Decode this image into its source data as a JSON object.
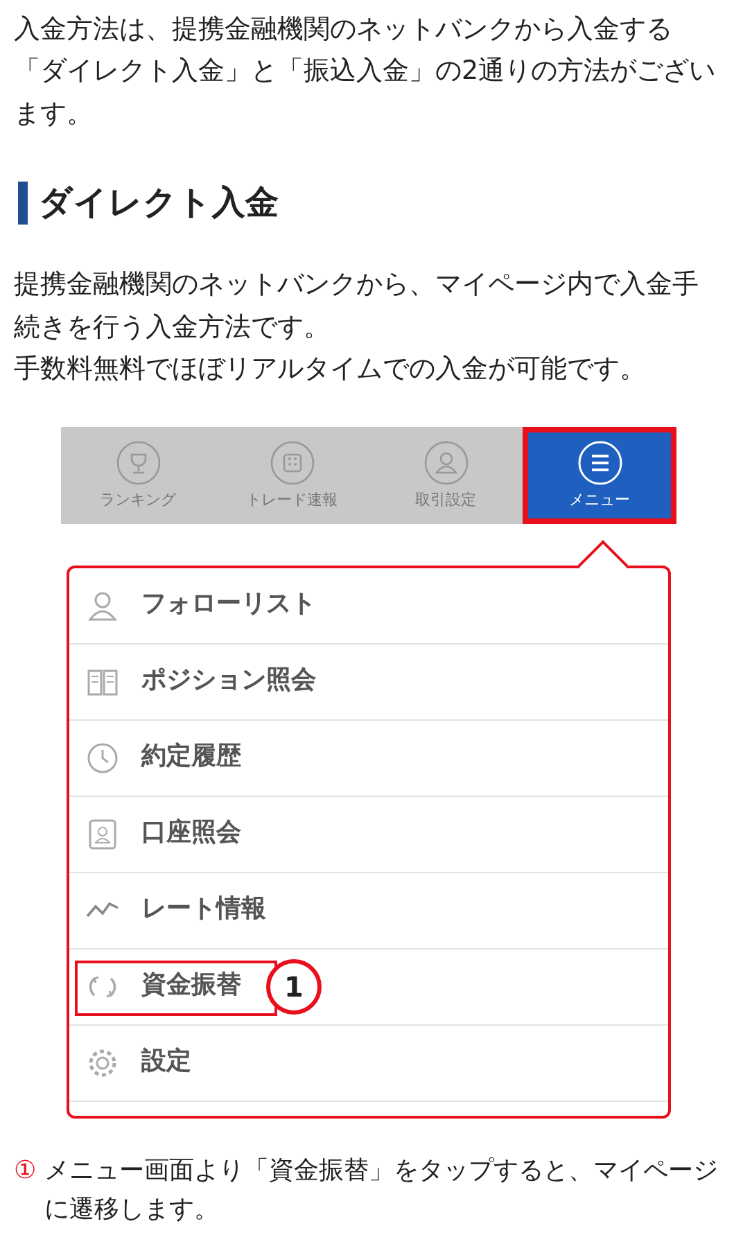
{
  "intro": "入金方法は、提携金融機関のネットバンクから入金する「ダイレクト入金」と「振込入金」の2通りの方法がございます。",
  "heading": "ダイレクト入金",
  "paragraphs": [
    "提携金融機関のネットバンクから、マイページ内で入金手続きを行う入金方法です。",
    "手数料無料でほぼリアルタイムでの入金が可能です。"
  ],
  "app_screen": {
    "tabs": [
      {
        "label": "ランキング",
        "selected": false
      },
      {
        "label": "トレード速報",
        "selected": false
      },
      {
        "label": "取引設定",
        "selected": false
      },
      {
        "label": "メニュー",
        "selected": true
      }
    ],
    "menu_items": [
      {
        "label": "フォローリスト",
        "highlighted": false
      },
      {
        "label": "ポジション照会",
        "highlighted": false
      },
      {
        "label": "約定履歴",
        "highlighted": false
      },
      {
        "label": "口座照会",
        "highlighted": false
      },
      {
        "label": "レート情報",
        "highlighted": false
      },
      {
        "label": "資金振替",
        "highlighted": true,
        "step": "1"
      },
      {
        "label": "設定",
        "highlighted": false
      }
    ]
  },
  "note": {
    "marker": "①",
    "text": "メニュー画面より「資金振替」をタップすると、マイページに遷移します。"
  }
}
